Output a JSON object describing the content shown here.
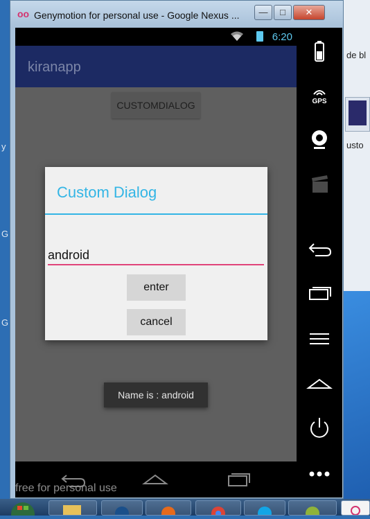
{
  "window": {
    "title": "Genymotion for personal use - Google Nexus ...",
    "controls": {
      "minimize": "—",
      "maximize": "□",
      "close": "✕"
    }
  },
  "status_bar": {
    "time": "6:20"
  },
  "app": {
    "title": "kiranapp"
  },
  "main": {
    "custom_dialog_button": "CUSTOMDIALOG"
  },
  "dialog": {
    "title": "Custom Dialog",
    "input_value": "android",
    "enter_label": "enter",
    "cancel_label": "cancel"
  },
  "toast": {
    "text": "Name is : android"
  },
  "side_panel": {
    "gps_label": "GPS"
  },
  "watermark": "free for personal use",
  "desktop": {
    "right_text_1": "de bl",
    "right_text_2": "usto",
    "left_letters": [
      "y",
      "G",
      "G"
    ]
  },
  "colors": {
    "accent": "#33b5e5",
    "input_underline": "#e0437a",
    "app_bar": "#1c2a63"
  }
}
